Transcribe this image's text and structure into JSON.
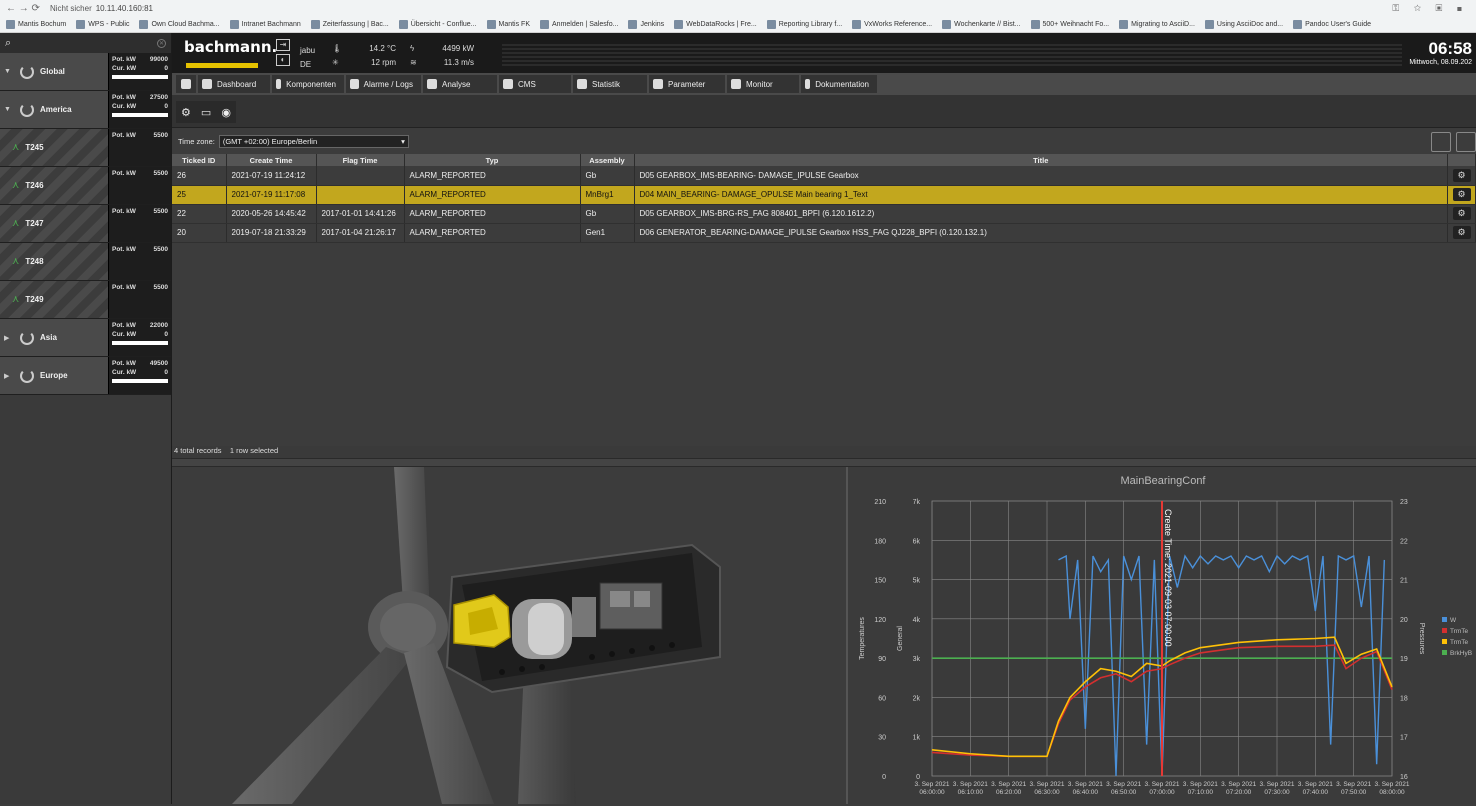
{
  "browser": {
    "security": "Nicht sicher",
    "url": "10.11.40.160:81"
  },
  "bookmarks": [
    "Mantis Bochum",
    "WPS - Public",
    "Own Cloud Bachma...",
    "Intranet Bachmann",
    "Zeiterfassung | Bac...",
    "Übersicht - Conflue...",
    "Mantis FK",
    "Anmelden | Salesfo...",
    "Jenkins",
    "WebDataRocks | Fre...",
    "Reporting Library f...",
    "VxWorks Reference...",
    "Wochenkarte // Bist...",
    "500+ Weihnacht Fo...",
    "Migrating to AsciiD...",
    "Using AsciiDoc and...",
    "Pandoc User's Guide"
  ],
  "sidebar": {
    "nodes": [
      {
        "name": "Global",
        "arrow": "▼",
        "type": "region",
        "pot_label": "Pot. kW",
        "pot": "99000",
        "cur_label": "Cur. kW",
        "cur": "0"
      },
      {
        "name": "America",
        "arrow": "▼",
        "type": "region",
        "pot_label": "Pot. kW",
        "pot": "27500",
        "cur_label": "Cur. kW",
        "cur": "0"
      },
      {
        "name": "T245",
        "arrow": "",
        "type": "turbine",
        "pot_label": "Pot. kW",
        "pot": "5500"
      },
      {
        "name": "T246",
        "arrow": "",
        "type": "turbine",
        "pot_label": "Pot. kW",
        "pot": "5500"
      },
      {
        "name": "T247",
        "arrow": "",
        "type": "turbine",
        "pot_label": "Pot. kW",
        "pot": "5500"
      },
      {
        "name": "T248",
        "arrow": "",
        "type": "turbine",
        "pot_label": "Pot. kW",
        "pot": "5500"
      },
      {
        "name": "T249",
        "arrow": "",
        "type": "turbine",
        "pot_label": "Pot. kW",
        "pot": "5500"
      },
      {
        "name": "Asia",
        "arrow": "▶",
        "type": "region",
        "pot_label": "Pot. kW",
        "pot": "22000",
        "cur_label": "Cur. kW",
        "cur": "0"
      },
      {
        "name": "Europe",
        "arrow": "▶",
        "type": "region",
        "pot_label": "Pot. kW",
        "pot": "49500",
        "cur_label": "Cur. kW",
        "cur": "0"
      }
    ]
  },
  "header": {
    "logo": "bachmann.",
    "user": "jabu",
    "lang": "DE",
    "temperature": "14.2 °C",
    "rotor_speed": "12 rpm",
    "power": "4499 kW",
    "wind_speed": "11.3 m/s",
    "time": "06:58",
    "date": "Mittwoch, 08.09.202"
  },
  "tabs": {
    "dashboard": "Dashboard",
    "komponenten": "Komponenten",
    "alarme": "Alarme / Logs",
    "analyse": "Analyse",
    "cms": "CMS",
    "statistik": "Statistik",
    "parameter": "Parameter",
    "monitor": "Monitor",
    "dokumentation": "Dokumentation"
  },
  "timezone": {
    "label": "Time zone:",
    "value": "(GMT +02:00) Europe/Berlin"
  },
  "table": {
    "columns": [
      "Ticked ID",
      "Create Time",
      "Flag Time",
      "Typ",
      "Assembly",
      "Title"
    ],
    "rows": [
      {
        "id": "26",
        "create": "2021-07-19 11:24:12",
        "flag": "",
        "typ": "ALARM_REPORTED",
        "assembly": "Gb",
        "title": "D05 GEARBOX_IMS-BEARING- DAMAGE_IPULSE Gearbox",
        "selected": false
      },
      {
        "id": "25",
        "create": "2021-07-19 11:17:08",
        "flag": "",
        "typ": "ALARM_REPORTED",
        "assembly": "MnBrg1",
        "title": "D04 MAIN_BEARING- DAMAGE_OPULSE Main bearing 1_Text",
        "selected": true
      },
      {
        "id": "22",
        "create": "2020-05-26 14:45:42",
        "flag": "2017-01-01 14:41:26",
        "typ": "ALARM_REPORTED",
        "assembly": "Gb",
        "title": "D05 GEARBOX_IMS-BRG-RS_FAG 808401_BPFI (6.120.1612.2)",
        "selected": false
      },
      {
        "id": "20",
        "create": "2019-07-18 21:33:29",
        "flag": "2017-01-04 21:26:17",
        "typ": "ALARM_REPORTED",
        "assembly": "Gen1",
        "title": "D06 GENERATOR_BEARING-DAMAGE_IPULSE Gearbox HSS_FAG QJ228_BPFI (0.120.132.1)",
        "selected": false
      }
    ]
  },
  "status": {
    "records": "4 total records",
    "selected": "1 row selected"
  },
  "chart_data": {
    "type": "line",
    "title": "MainBearingConf",
    "ylabel_left1": "Temperatures",
    "ylabel_left2": "General",
    "ylabel_right": "Pressures",
    "y_temp_ticks": [
      "0",
      "30",
      "60",
      "90",
      "120",
      "150",
      "180",
      "210"
    ],
    "y_gen_ticks": [
      "0",
      "1k",
      "2k",
      "3k",
      "4k",
      "5k",
      "6k",
      "7k"
    ],
    "y_press_ticks": [
      "16",
      "17",
      "18",
      "19",
      "20",
      "21",
      "22",
      "23"
    ],
    "x_ticks": [
      [
        "3. Sep 2021",
        "06:00:00"
      ],
      [
        "3. Sep 2021",
        "06:10:00"
      ],
      [
        "3. Sep 2021",
        "06:20:00"
      ],
      [
        "3. Sep 2021",
        "06:30:00"
      ],
      [
        "3. Sep 2021",
        "06:40:00"
      ],
      [
        "3. Sep 2021",
        "06:50:00"
      ],
      [
        "3. Sep 2021",
        "07:00:00"
      ],
      [
        "3. Sep 2021",
        "07:10:00"
      ],
      [
        "3. Sep 2021",
        "07:20:00"
      ],
      [
        "3. Sep 2021",
        "07:30:00"
      ],
      [
        "3. Sep 2021",
        "07:40:00"
      ],
      [
        "3. Sep 2021",
        "07:50:00"
      ],
      [
        "3. Sep 2021",
        "08:00:00"
      ]
    ],
    "marker_label": "Create Time: 2021-09-03 07:00:00",
    "marker_x": 60,
    "legend": [
      "W",
      "TrmTe",
      "TrmTe",
      "BrkHyB"
    ],
    "legend_colors": [
      "#4a90d9",
      "#d32f2f",
      "#ffc107",
      "#4caf50"
    ],
    "series": [
      {
        "color": "#d32f2f",
        "axis": "temp",
        "x": [
          0,
          10,
          20,
          30,
          33,
          36,
          40,
          44,
          48,
          52,
          56,
          60,
          62,
          66,
          70,
          80,
          90,
          100,
          105,
          108,
          112,
          116,
          120
        ],
        "values": [
          18,
          16,
          15,
          15,
          40,
          58,
          68,
          75,
          78,
          72,
          80,
          82,
          85,
          90,
          94,
          98,
          99,
          99,
          100,
          82,
          90,
          95,
          66
        ]
      },
      {
        "color": "#ffc107",
        "axis": "temp",
        "x": [
          0,
          10,
          20,
          30,
          33,
          36,
          40,
          44,
          48,
          52,
          56,
          60,
          62,
          66,
          70,
          80,
          90,
          100,
          105,
          108,
          112,
          116,
          120
        ],
        "values": [
          20,
          17,
          15,
          15,
          42,
          60,
          72,
          82,
          80,
          76,
          86,
          84,
          88,
          94,
          98,
          102,
          104,
          105,
          106,
          86,
          93,
          97,
          68
        ]
      },
      {
        "color": "#4caf50",
        "axis": "temp",
        "x": [
          0,
          120
        ],
        "values": [
          90,
          90
        ]
      },
      {
        "color": "#4a90d9",
        "axis": "gen",
        "x": [
          33,
          35,
          36,
          38,
          40,
          42,
          44,
          46,
          48,
          50,
          52,
          54,
          56,
          58,
          60,
          62,
          64,
          66,
          68,
          70,
          72,
          74,
          76,
          78,
          80,
          82,
          84,
          86,
          88,
          90,
          92,
          94,
          96,
          98,
          100,
          102,
          104,
          106,
          108,
          110,
          112,
          114,
          116,
          118
        ],
        "values": [
          5500,
          5600,
          4000,
          5500,
          1200,
          5600,
          5200,
          5500,
          0,
          5600,
          5000,
          5600,
          800,
          5500,
          0,
          5600,
          4800,
          5600,
          5300,
          5600,
          5400,
          5600,
          5500,
          5600,
          5300,
          5600,
          5500,
          5600,
          5200,
          5600,
          5400,
          5600,
          5500,
          5600,
          4200,
          5600,
          800,
          5600,
          5500,
          5600,
          4300,
          5600,
          300,
          5500
        ]
      }
    ]
  }
}
